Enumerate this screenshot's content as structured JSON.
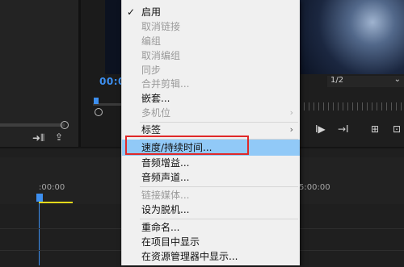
{
  "menu": {
    "items": [
      {
        "label": "启用",
        "checked": true
      },
      {
        "label": "取消链接",
        "disabled": true
      },
      {
        "label": "编组",
        "disabled": true
      },
      {
        "label": "取消编组",
        "disabled": true
      },
      {
        "label": "同步",
        "disabled": true
      },
      {
        "label": "合并剪辑...",
        "disabled": true
      },
      {
        "label": "嵌套..."
      },
      {
        "label": "多机位",
        "disabled": true,
        "submenu": true
      },
      {
        "label": "标签",
        "submenu": true
      },
      {
        "label": "速度/持续时间...",
        "highlighted": true
      },
      {
        "label": "音频增益..."
      },
      {
        "label": "音频声道..."
      },
      {
        "label": "链接媒体...",
        "disabled": true
      },
      {
        "label": "设为脱机..."
      },
      {
        "label": "重命名..."
      },
      {
        "label": "在项目中显示"
      },
      {
        "label": "在资源管理器中显示..."
      }
    ],
    "submenu_arrow": "›",
    "check_mark": "✓"
  },
  "program_monitor": {
    "timecode": "00:0",
    "resolution": "1/2"
  },
  "timeline": {
    "time_start": ":00:00",
    "time_right": "5:00:00"
  },
  "colors": {
    "accent": "#3d8ff0",
    "menu_highlight": "#91c9f7",
    "annotation_box": "#e02828"
  }
}
